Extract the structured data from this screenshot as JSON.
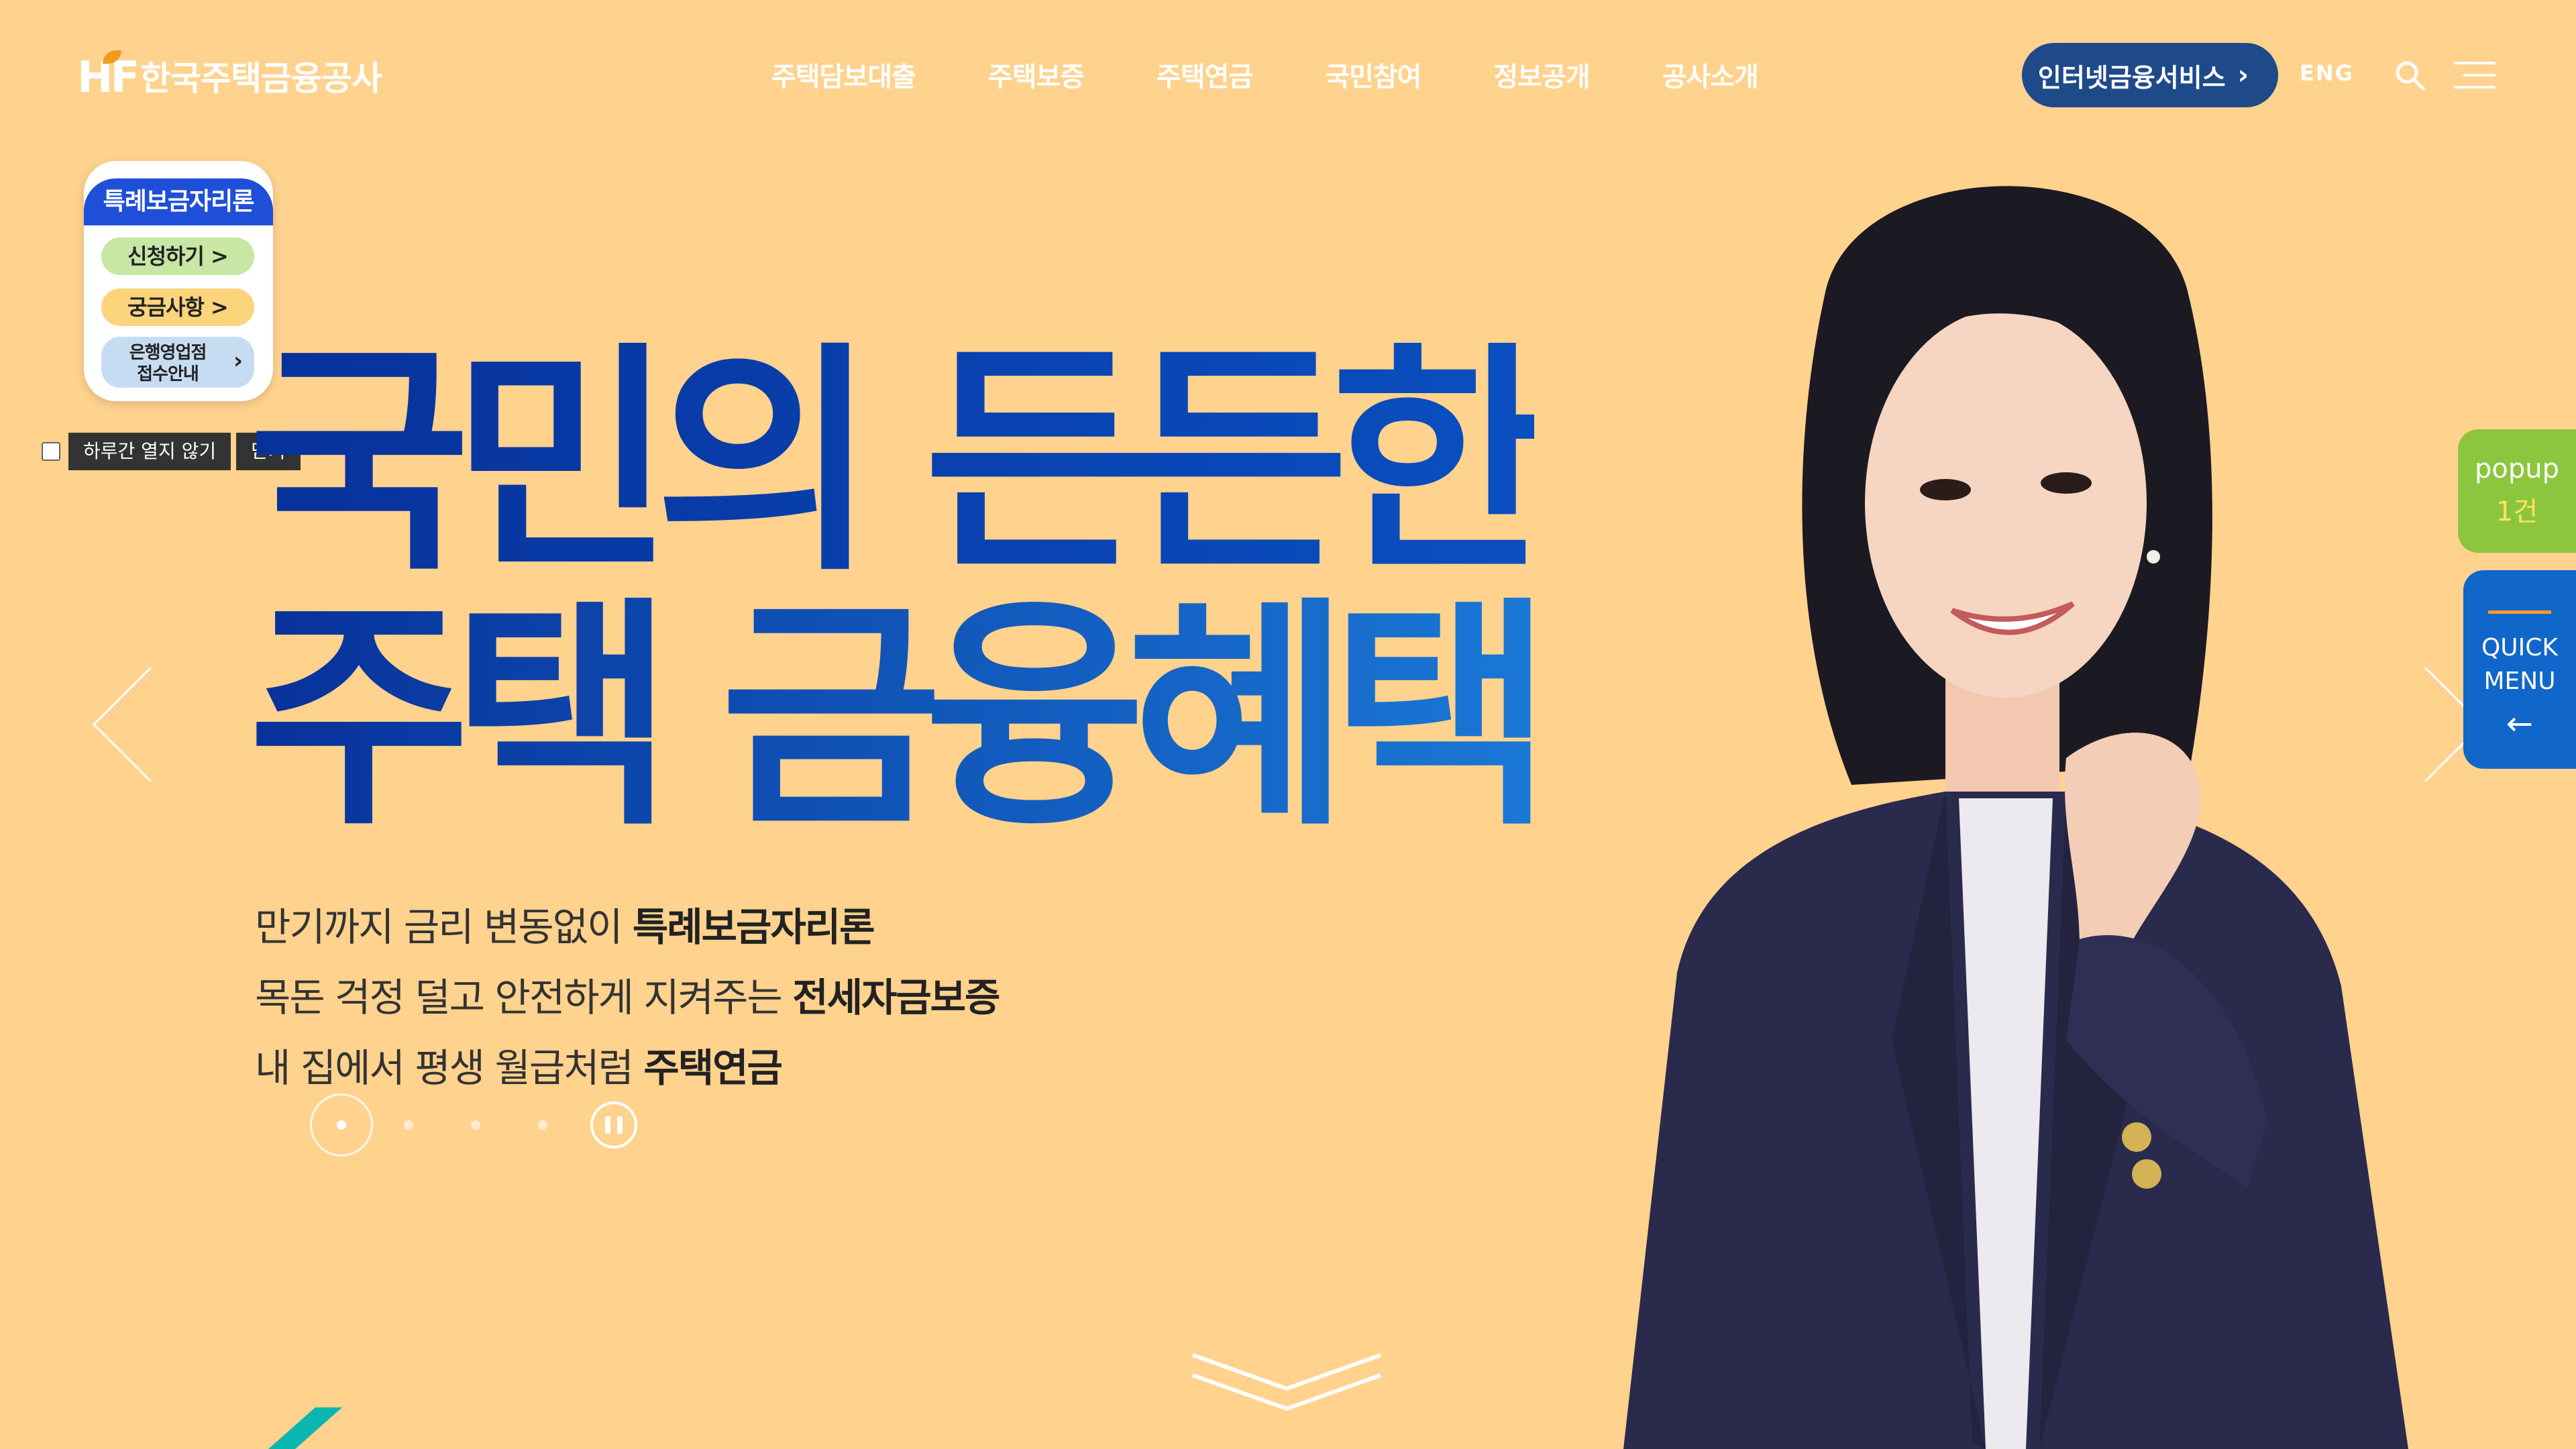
{
  "header": {
    "logo_mark": "HF",
    "logo_text": "한국주택금융공사",
    "nav": [
      "주택담보대출",
      "주택보증",
      "주택연금",
      "국민참여",
      "정보공개",
      "공사소개"
    ],
    "ibank_label": "인터넷금융서비스",
    "lang_label": "ENG"
  },
  "popup": {
    "title": "특례보금자리론",
    "btn_apply": "신청하기 >",
    "btn_faq": "궁금사항 >",
    "btn_branch_line1": "은행영업점",
    "btn_branch_line2": "접수안내",
    "dont_show_label": "하루간 열지 않기",
    "close_label": "닫기"
  },
  "hero": {
    "headline_line1": "국민의 든든한",
    "headline_line2": "주택 금융혜택",
    "sub1_plain": "만기까지 금리 변동없이 ",
    "sub1_bold": "특례보금자리론",
    "sub2_plain": "목돈 걱정 덜고 안전하게 지켜주는 ",
    "sub2_bold": "전세자금보증",
    "sub3_plain": "내 집에서 평생 월급처럼 ",
    "sub3_bold": "주택연금"
  },
  "carousel": {
    "total_slides": 4,
    "current_slide": 1
  },
  "floating": {
    "popup_label": "popup",
    "popup_count": "1건",
    "quick_line1": "QUICK",
    "quick_line2": "MENU"
  },
  "colors": {
    "background": "#ffd28e",
    "headline_blue": "#0a3aa8",
    "ibank_btn": "#1f4a8a",
    "popup_green": "#8cc63f",
    "quick_blue": "#1166c9"
  }
}
